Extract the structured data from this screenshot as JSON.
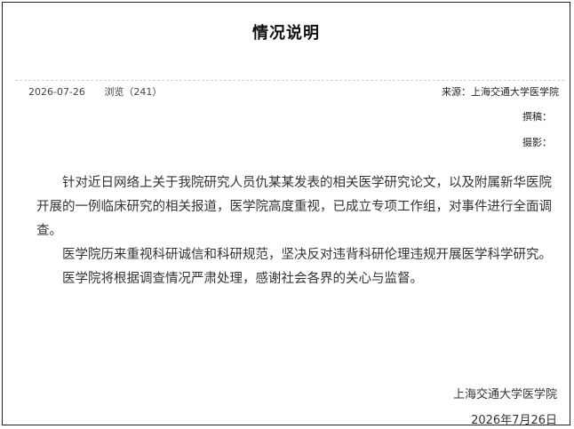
{
  "article": {
    "title": "情况说明",
    "date": "2026-07-26",
    "views": "浏览（241）",
    "source": "来源：上海交通大学医学院",
    "writer": "撰稿：",
    "photographer": "摄影：",
    "paragraphs": [
      "针对近日网络上关于我院研究人员仇某某发表的相关医学研究论文，以及附属新华医院开展的一例临床研究的相关报道，医学院高度重视，已成立专项工作组，对事件进行全面调查。",
      "医学院历来重视科研诚信和科研规范，坚决反对违背科研伦理违规开展医学科学研究。",
      "医学院将根据调查情况严肃处理，感谢社会各界的关心与监督。"
    ],
    "signature_org": "上海交通大学医学院",
    "signature_date": "2026年7月26日"
  }
}
